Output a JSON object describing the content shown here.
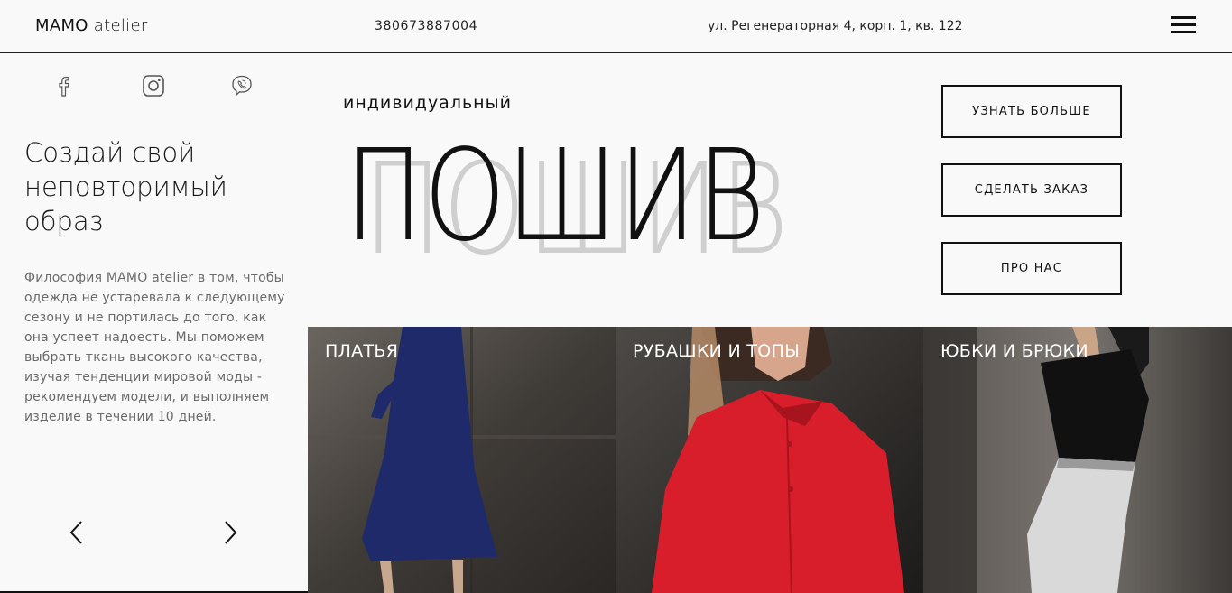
{
  "header": {
    "logo_main": "MAMO",
    "logo_sub": "atelier",
    "phone": "380673887004",
    "address": "ул. Регенераторная 4, корп. 1, кв. 122",
    "menu_icon": "hamburger-menu-icon"
  },
  "social": [
    {
      "icon": "facebook-icon"
    },
    {
      "icon": "instagram-icon"
    },
    {
      "icon": "viber-icon"
    }
  ],
  "intro": {
    "headline": "Создай свой\nнеповторимый\nобраз",
    "philosophy": "Философия MAMO atelier в том, чтобы одежда не устаревала к следующему сезону и не портилась до того, как она успеет надоесть. Мы поможем выбрать ткань высокого качества, изучая тенденции мировой моды - рекомендуем модели, и выполняем изделие в течении 10 дней."
  },
  "slider": {
    "prev_icon": "chevron-left-icon",
    "next_icon": "chevron-right-icon"
  },
  "hero": {
    "subtitle": "индивидуальный",
    "title": "ПОШИВ",
    "colors": {
      "title": "#111111",
      "shadow": "#cfcfcf"
    }
  },
  "buttons": {
    "learn_more": "УЗНАТЬ БОЛЬШЕ",
    "order": "СДЕЛАТЬ ЗАКАЗ",
    "about": "ПРО НАС"
  },
  "categories": [
    {
      "label": "ПЛАТЬЯ",
      "garment_color": "#1f2a6b"
    },
    {
      "label": "РУБАШКИ И ТОПЫ",
      "garment_color": "#d81e2a"
    },
    {
      "label": "ЮБКИ И БРЮКИ",
      "garment_color": "#d9d9d9"
    }
  ]
}
